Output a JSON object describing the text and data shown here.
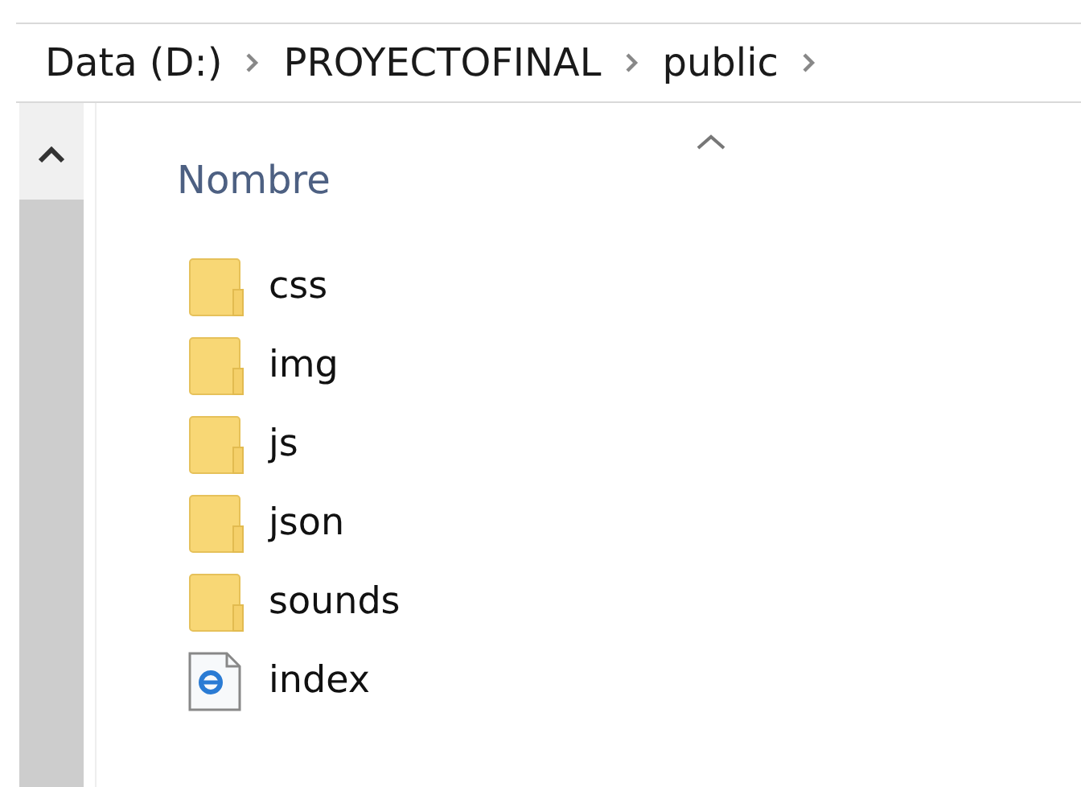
{
  "breadcrumb": [
    {
      "label": "Data (D:)"
    },
    {
      "label": "PROYECTOFINAL"
    },
    {
      "label": "public"
    }
  ],
  "column": {
    "label": "Nombre",
    "sorted": true
  },
  "files": [
    {
      "name": "css",
      "kind": "folder"
    },
    {
      "name": "img",
      "kind": "folder"
    },
    {
      "name": "js",
      "kind": "folder"
    },
    {
      "name": "json",
      "kind": "folder"
    },
    {
      "name": "sounds",
      "kind": "folder"
    },
    {
      "name": "index",
      "kind": "html"
    }
  ]
}
